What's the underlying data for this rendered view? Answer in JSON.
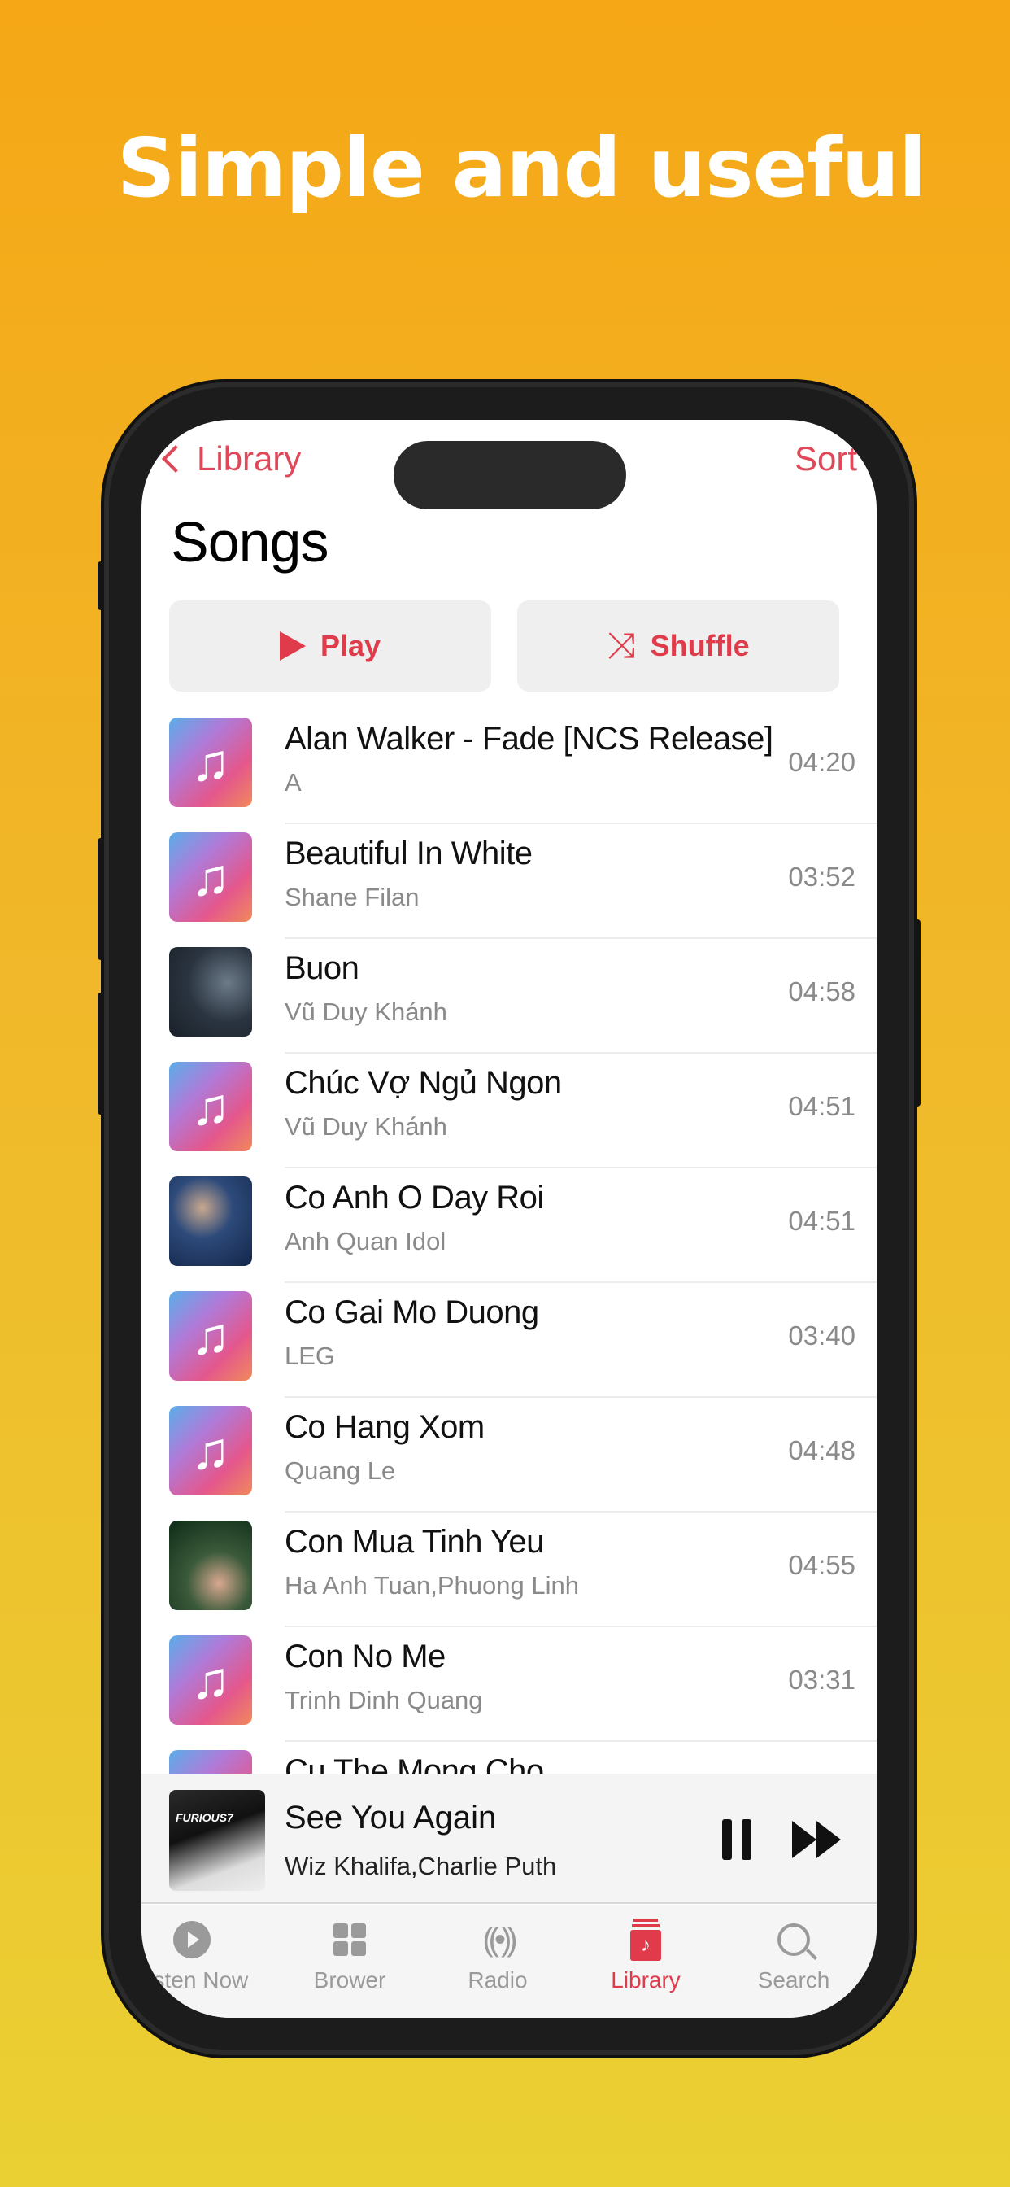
{
  "headline": "Simple and useful",
  "colors": {
    "accent": "#e03b4a",
    "background_top": "#f5a716",
    "background_bottom": "#ead033"
  },
  "nav": {
    "back_label": "Library",
    "back_icon": "chevron-left-icon",
    "sort_label": "Sort"
  },
  "page_title": "Songs",
  "actions": {
    "play": {
      "label": "Play",
      "icon": "play-icon"
    },
    "shuffle": {
      "label": "Shuffle",
      "icon": "shuffle-icon",
      "glyph": "⤨"
    }
  },
  "songs": [
    {
      "title": "Alan Walker - Fade [NCS Release]",
      "artist": "A",
      "duration": "04:20",
      "artwork": "default"
    },
    {
      "title": "Beautiful In White",
      "artist": "Shane Filan",
      "duration": "03:52",
      "artwork": "default"
    },
    {
      "title": "Buon",
      "artist": "Vũ Duy Khánh",
      "duration": "04:58",
      "artwork": "photo-dark"
    },
    {
      "title": "Chúc Vợ Ngủ Ngon",
      "artist": "Vũ Duy Khánh",
      "duration": "04:51",
      "artwork": "default"
    },
    {
      "title": "Co Anh O Day Roi",
      "artist": "Anh Quan Idol",
      "duration": "04:51",
      "artwork": "photo-blue"
    },
    {
      "title": "Co Gai Mo Duong",
      "artist": "LEG",
      "duration": "03:40",
      "artwork": "default"
    },
    {
      "title": "Co Hang Xom",
      "artist": "Quang Le",
      "duration": "04:48",
      "artwork": "default"
    },
    {
      "title": "Con Mua Tinh Yeu",
      "artist": "Ha Anh Tuan,Phuong Linh",
      "duration": "04:55",
      "artwork": "photo-green"
    },
    {
      "title": "Con No Me",
      "artist": "Trinh Dinh Quang",
      "duration": "03:31",
      "artwork": "default"
    },
    {
      "title": "Cu The Mong Cho",
      "artist": "",
      "duration": "",
      "artwork": "default"
    }
  ],
  "note_glyph": "♫",
  "now_playing": {
    "title": "See You Again",
    "artist": "Wiz Khalifa,Charlie Puth",
    "art_text": "FURIOUS7",
    "pause_icon": "pause-icon",
    "next_icon": "fast-forward-icon"
  },
  "tabs": [
    {
      "label": "Listen Now",
      "icon": "play-circle-icon",
      "active": false
    },
    {
      "label": "Brower",
      "icon": "grid-icon",
      "active": false
    },
    {
      "label": "Radio",
      "icon": "radio-waves-icon",
      "glyph": "((•))",
      "active": false
    },
    {
      "label": "Library",
      "icon": "library-icon",
      "glyph": "♪",
      "active": true
    },
    {
      "label": "Search",
      "icon": "search-icon",
      "active": false
    }
  ]
}
